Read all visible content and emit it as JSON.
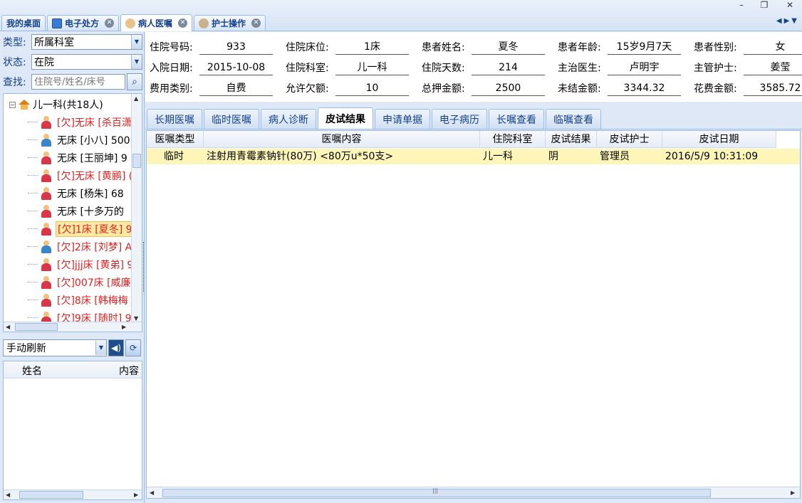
{
  "window_controls": {
    "minimize": "–",
    "restore": "❐",
    "close": "✕"
  },
  "doc_tabs": [
    {
      "label": "我的桌面"
    },
    {
      "label": "电子处方"
    },
    {
      "label": "病人医嘱"
    },
    {
      "label": "护士操作"
    }
  ],
  "tab_scroll": {
    "left": "◀",
    "right": "▶",
    "menu": "▼"
  },
  "filters": {
    "type_label": "类型:",
    "type_value": "所属科室",
    "status_label": "状态:",
    "status_value": "在院",
    "search_label": "查找:",
    "search_placeholder": "住院号/姓名/床号"
  },
  "tree": {
    "root_label": "儿一科(共18人)",
    "patients": [
      {
        "text": "[欠]无床 [杀百潇",
        "owing": true,
        "gender": "female"
      },
      {
        "text": "无床 [小八] 500",
        "owing": false,
        "gender": "male"
      },
      {
        "text": "无床 [王丽坤] 9",
        "owing": false,
        "gender": "female"
      },
      {
        "text": "[欠]无床 [黄鹂] (",
        "owing": true,
        "gender": "female"
      },
      {
        "text": "无床 [杨朱] 68",
        "owing": false,
        "gender": "female"
      },
      {
        "text": "无床 [十多万的",
        "owing": false,
        "gender": "female"
      },
      {
        "text": "[欠]1床 [夏冬] 9",
        "owing": true,
        "gender": "female",
        "selected": true
      },
      {
        "text": "[欠]2床 [刘梦] A",
        "owing": true,
        "gender": "male"
      },
      {
        "text": "[欠]jjj床 [黄弟] 9",
        "owing": true,
        "gender": "female"
      },
      {
        "text": "[欠]007床 [威廉",
        "owing": true,
        "gender": "female"
      },
      {
        "text": "[欠]8床 [韩梅梅",
        "owing": true,
        "gender": "female"
      },
      {
        "text": "[欠]9床 [随时] 9",
        "owing": true,
        "gender": "female"
      }
    ]
  },
  "refresh": {
    "value": "手动刷新"
  },
  "messages": {
    "col_name": "姓名",
    "col_content": "内容"
  },
  "patient_info": {
    "row1": [
      {
        "label": "住院号码:",
        "value": "933"
      },
      {
        "label": "住院床位:",
        "value": "1床"
      },
      {
        "label": "患者姓名:",
        "value": "夏冬"
      },
      {
        "label": "患者年龄:",
        "value": "15岁9月7天"
      },
      {
        "label": "患者性别:",
        "value": "女"
      }
    ],
    "row2": [
      {
        "label": "入院日期:",
        "value": "2015-10-08"
      },
      {
        "label": "住院科室:",
        "value": "儿一科"
      },
      {
        "label": "住院天数:",
        "value": "214"
      },
      {
        "label": "主治医生:",
        "value": "卢明宇"
      },
      {
        "label": "主管护士:",
        "value": "姜莹"
      }
    ],
    "row3": [
      {
        "label": "费用类别:",
        "value": "自费"
      },
      {
        "label": "允许欠额:",
        "value": "10"
      },
      {
        "label": "总押金额:",
        "value": "2500"
      },
      {
        "label": "未结金额:",
        "value": "3344.32"
      },
      {
        "label": "花费金额:",
        "value": "3585.72"
      }
    ]
  },
  "sub_tabs": [
    "长期医嘱",
    "临时医嘱",
    "病人诊断",
    "皮试结果",
    "申请单据",
    "电子病历",
    "长嘱查看",
    "临嘱查看"
  ],
  "active_sub_tab": "皮试结果",
  "grid": {
    "columns": [
      "医嘱类型",
      "医嘱内容",
      "住院科室",
      "皮试结果",
      "皮试护士",
      "皮试日期"
    ],
    "rows": [
      [
        "临时",
        "注射用青霉素钠针(80万) <80万u*50支>",
        "儿一科",
        "阴",
        "管理员",
        "2016/5/9 10:31:09"
      ]
    ]
  },
  "scroll_glyphs": {
    "up": "▲",
    "down": "▼",
    "left": "◀",
    "right": "▶",
    "grip": "|||"
  },
  "colors": {
    "owing": "#e02020",
    "normal": "#000000",
    "selected_row": "#fef6b8",
    "accent": "#15428b"
  }
}
